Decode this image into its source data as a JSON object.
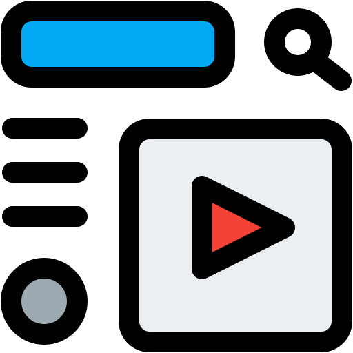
{
  "icon": {
    "name": "video-search-webpage-icon",
    "colors": {
      "outline": "#000000",
      "search_bar_fill": "#03A9F4",
      "player_fill": "#ECEFF1",
      "play_triangle_fill": "#F44336",
      "avatar_fill": "#9EAAB1",
      "background": "#FFFFFF"
    },
    "parts": [
      "search-bar",
      "magnifier-icon",
      "menu-lines",
      "video-player",
      "play-icon",
      "avatar-circle"
    ]
  }
}
